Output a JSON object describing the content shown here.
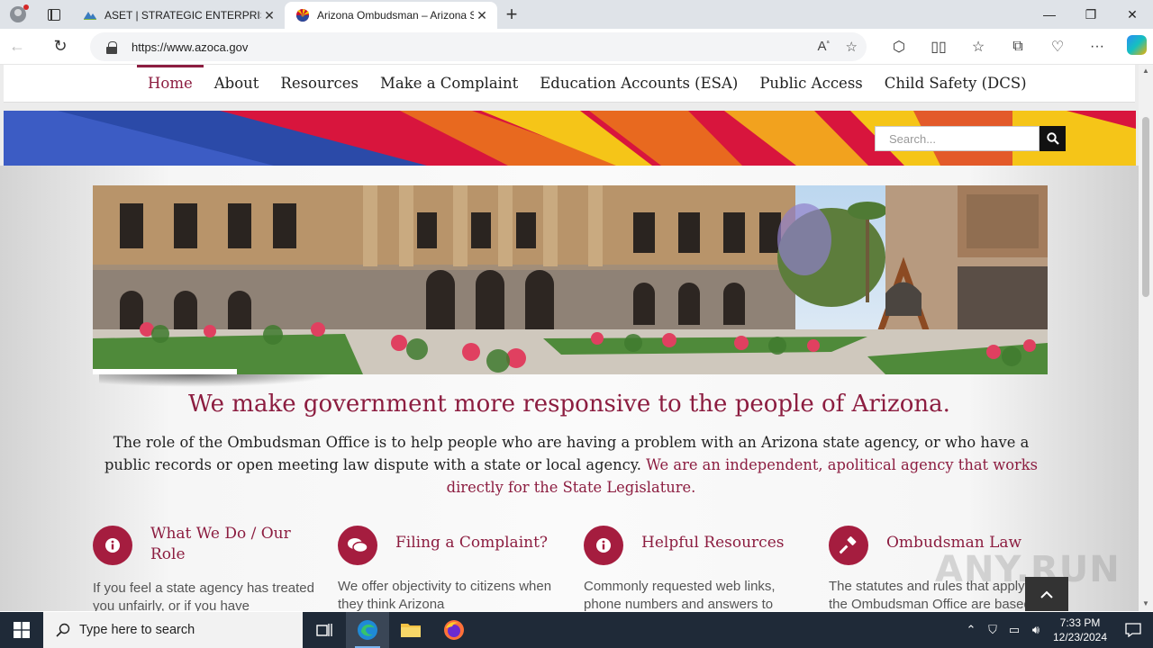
{
  "browser": {
    "tabs": [
      {
        "title": "ASET | STRATEGIC ENTERPRISE TE",
        "active": false
      },
      {
        "title": "Arizona Ombudsman – Arizona S",
        "active": true
      }
    ],
    "new_tab": "+",
    "url": "https://www.azoca.gov",
    "window_controls": {
      "minimize": "—",
      "maximize": "❐",
      "close": "✕"
    }
  },
  "site": {
    "nav": [
      {
        "label": "Home",
        "active": true
      },
      {
        "label": "About"
      },
      {
        "label": "Resources"
      },
      {
        "label": "Make a Complaint"
      },
      {
        "label": "Education Accounts (ESA)"
      },
      {
        "label": "Public Access"
      },
      {
        "label": "Child Safety (DCS)"
      }
    ],
    "search_placeholder": "Search...",
    "headline": "We make government more responsive to the people of Arizona.",
    "intro_text": "The role of the Ombudsman Office is to help people who are having a problem with an Arizona state agency, or who have a public records or open meeting law dispute with a state or local agency.",
    "intro_emphasis": "We are an independent, apolitical agency that works directly for the State Legislature.",
    "columns": [
      {
        "title": "What We Do / Our Role",
        "icon": "info-icon",
        "text": "If you feel a state agency has treated you unfairly, or if you have"
      },
      {
        "title": "Filing a Complaint?",
        "icon": "chat-bubbles-icon",
        "text": "We offer objectivity to citizens when they think Arizona"
      },
      {
        "title": "Helpful Resources",
        "icon": "info-icon",
        "text": "Commonly requested web links, phone numbers and answers to"
      },
      {
        "title": "Ombudsman Law",
        "icon": "gavel-icon",
        "text": "The statutes and rules that apply to the Ombudsman Office are based"
      }
    ],
    "watermark": "ANY.RUN"
  },
  "taskbar": {
    "search_placeholder": "Type here to search",
    "time": "7:33 PM",
    "date": "12/23/2024"
  },
  "colors": {
    "brand": "#8c1d40",
    "accent_icon_bg": "#a51d3f"
  }
}
